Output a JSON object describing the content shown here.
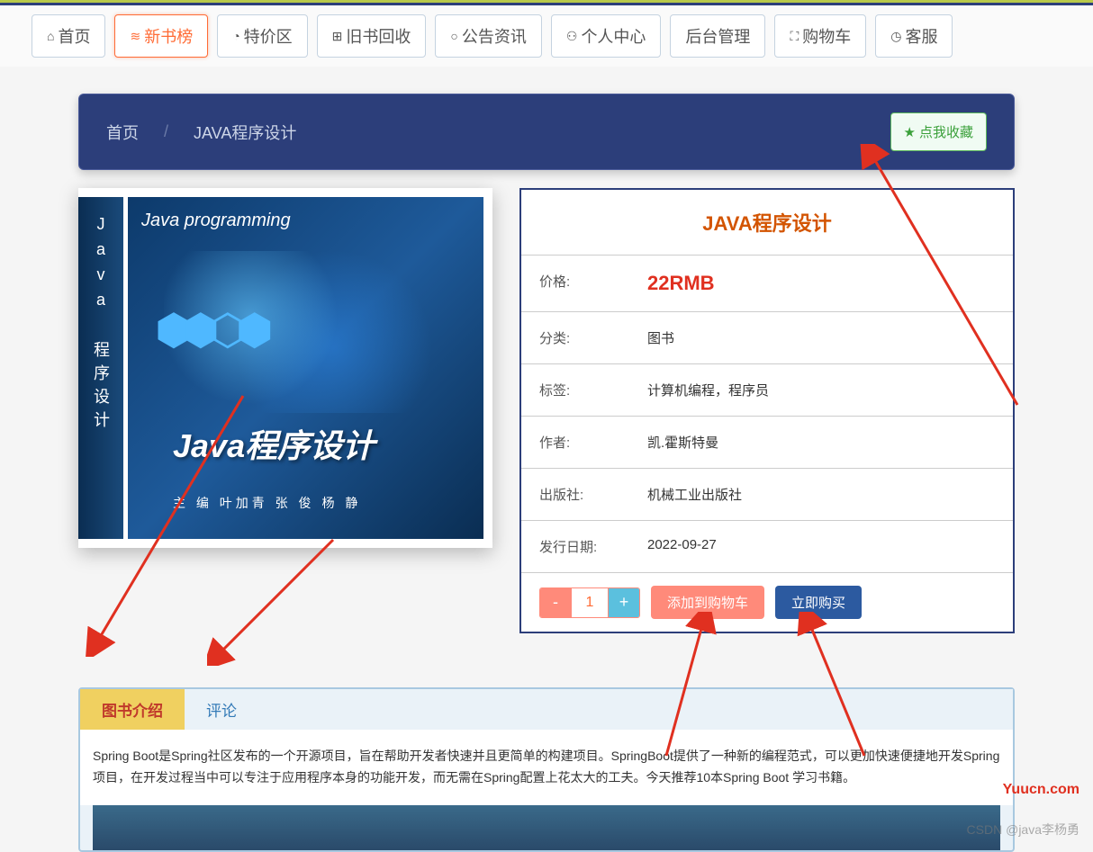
{
  "nav": [
    {
      "icon": "⌂",
      "label": "首页"
    },
    {
      "icon": "≋",
      "label": "新书榜",
      "active": true
    },
    {
      "icon": "◔",
      "label": "特价区"
    },
    {
      "icon": "⊞",
      "label": "旧书回收"
    },
    {
      "icon": "○",
      "label": "公告资讯"
    },
    {
      "icon": "⚇",
      "label": "个人中心"
    },
    {
      "icon": "",
      "label": "后台管理"
    },
    {
      "icon": "⛶",
      "label": "购物车"
    },
    {
      "icon": "◷",
      "label": "客服"
    }
  ],
  "breadcrumb": {
    "home": "首页",
    "sep": "/",
    "current": "JAVA程序设计",
    "fav": "点我收藏"
  },
  "book_cover": {
    "spine": "Java 程序设计",
    "subtitle": "Java programming",
    "title_cn": "Java程序设计",
    "authors": "主 编  叶加青  张 俊  杨  静"
  },
  "info": {
    "title": "JAVA程序设计",
    "rows": [
      {
        "label": "价格:",
        "value": "22RMB",
        "price": true
      },
      {
        "label": "分类:",
        "value": "图书"
      },
      {
        "label": "标签:",
        "value": "计算机编程，程序员"
      },
      {
        "label": "作者:",
        "value": "凯.霍斯特曼"
      },
      {
        "label": "出版社:",
        "value": "机械工业出版社"
      },
      {
        "label": "发行日期:",
        "value": "2022-09-27"
      }
    ],
    "qty": "1",
    "add_cart": "添加到购物车",
    "buy_now": "立即购买"
  },
  "tabs": [
    {
      "label": "图书介绍",
      "active": true
    },
    {
      "label": "评论"
    }
  ],
  "description": "Spring Boot是Spring社区发布的一个开源项目，旨在帮助开发者快速并且更简单的构建项目。SpringBoot提供了一种新的编程范式，可以更加快速便捷地开发Spring项目，在开发过程当中可以专注于应用程序本身的功能开发，而无需在Spring配置上花太大的工夫。今天推荐10本Spring Boot 学习书籍。",
  "watermarks": {
    "site": "Yuucn.com",
    "csdn": "CSDN @java李杨勇"
  }
}
